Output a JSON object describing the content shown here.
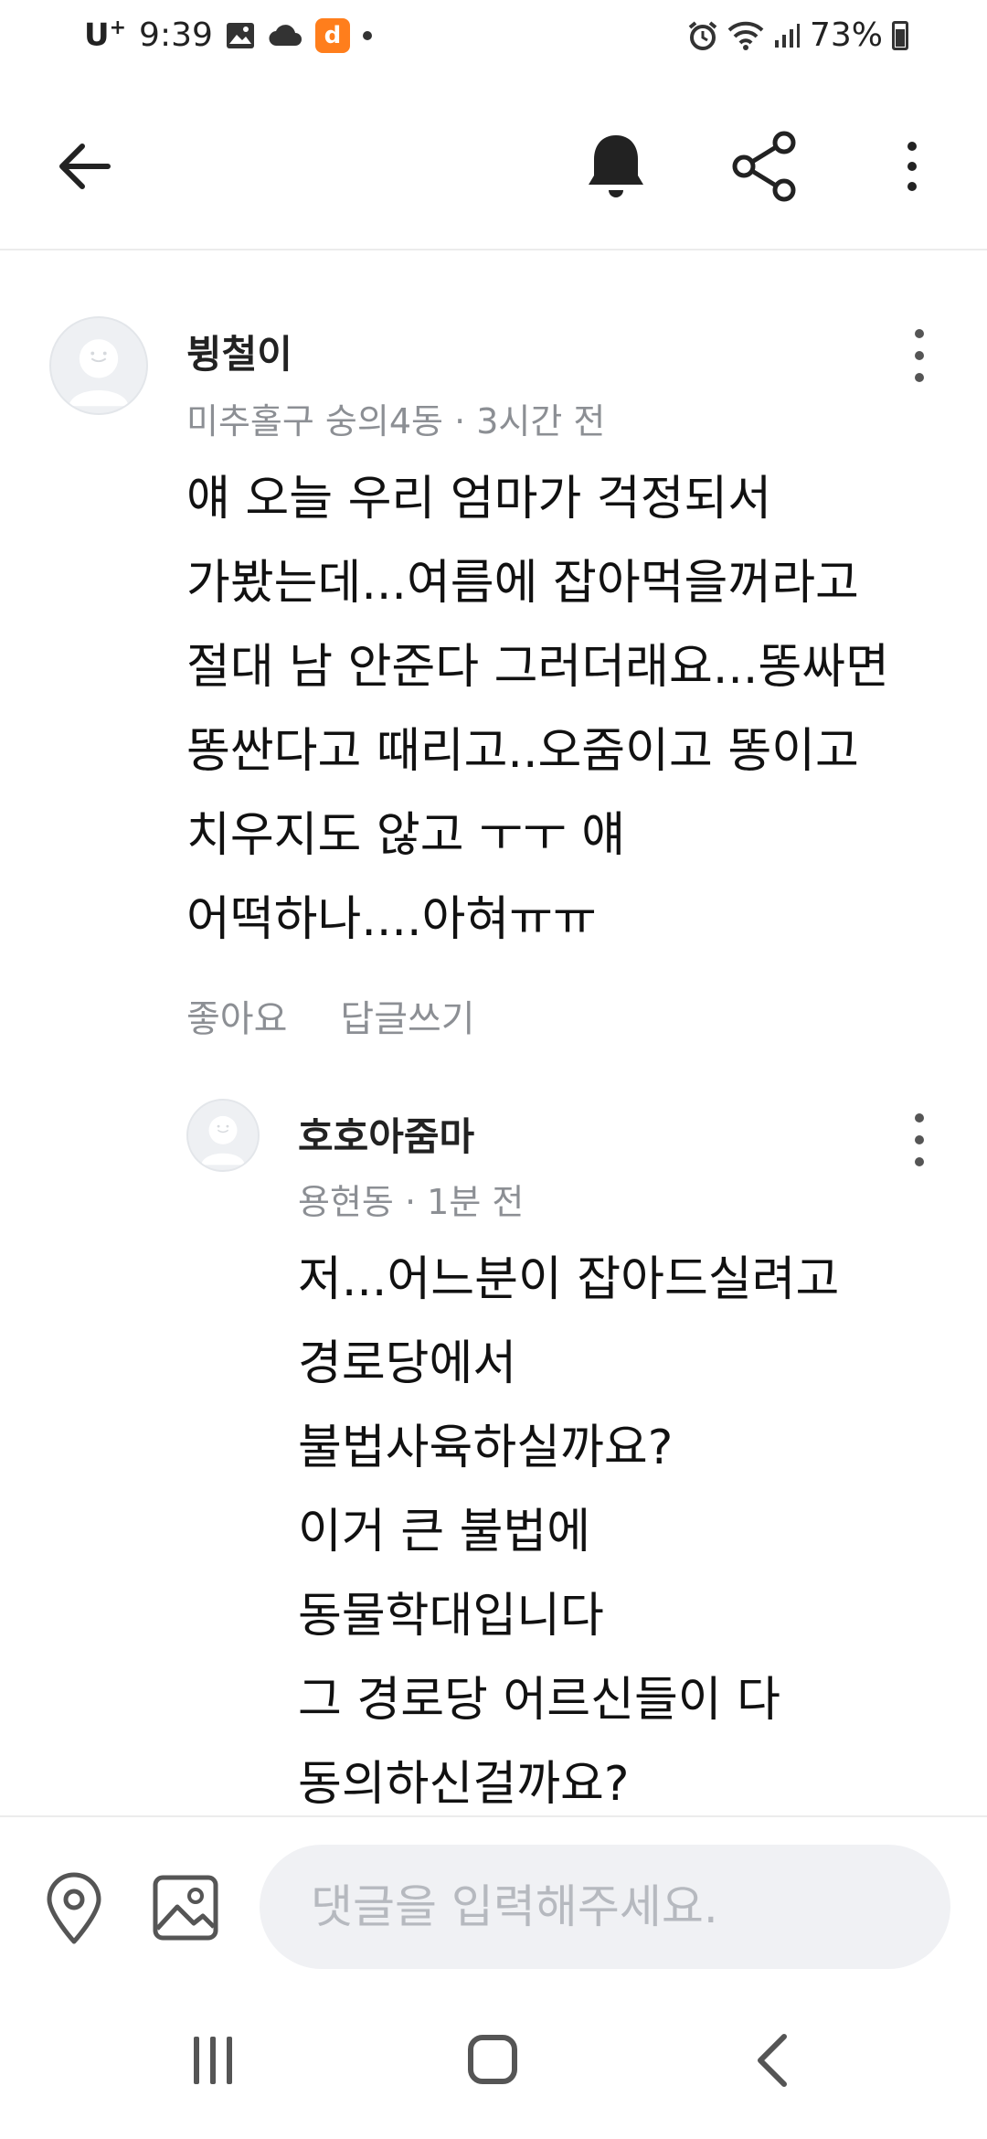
{
  "status_bar": {
    "carrier": "U",
    "carrier_sup": "+",
    "time": "9:39",
    "battery": "73%",
    "icons": [
      "gallery-icon",
      "cloud-icon",
      "app-notification-icon",
      "dot-icon",
      "alarm-icon",
      "wifi-icon",
      "signal-icon",
      "battery-icon"
    ]
  },
  "app_bar": {
    "icons": [
      "back-arrow-icon",
      "bell-icon",
      "share-icon",
      "more-vertical-icon"
    ]
  },
  "comments": [
    {
      "author": "뷩철이",
      "location": "미추홀구 숭의4동",
      "separator": " · ",
      "time": "3시간 전",
      "lines": [
        "얘 오늘 우리 엄마가 걱정되서",
        "가봤는데...여름에 잡아먹을꺼라고",
        "절대 남 안준다 그러더래요...똥싸면",
        "똥싼다고 때리고..오줌이고 똥이고",
        "치우지도 않고 ㅜㅜ 얘",
        "어떡하나....아혀ㅠㅠ"
      ],
      "like_label": "좋아요",
      "reply_label": "답글쓰기"
    },
    {
      "author": "호호아줌마",
      "location": "용현동",
      "separator": " · ",
      "time": "1분 전",
      "lines": [
        "저...어느분이 잡아드실려고",
        "경로당에서",
        "불법사육하실까요?",
        "이거 큰 불법에",
        "동물학대입니다",
        "그 경로당 어르신들이 다",
        "동의하신걸까요?"
      ]
    }
  ],
  "input_bar": {
    "placeholder": "댓글을 입력해주세요.",
    "value": ""
  },
  "nav_bar": {
    "icons": [
      "recent-apps-icon",
      "home-icon",
      "nav-back-icon"
    ]
  }
}
